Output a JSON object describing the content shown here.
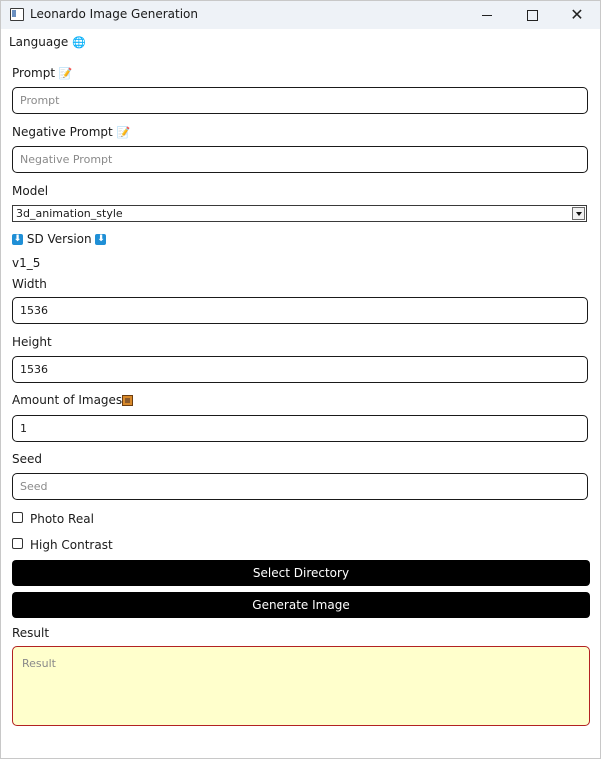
{
  "window": {
    "title": "Leonardo Image Generation",
    "controls": {
      "minimize": "minimize-icon",
      "maximize": "maximize-icon",
      "close": "close-icon"
    }
  },
  "language": {
    "label": "Language",
    "icon": "globe-icon"
  },
  "prompt": {
    "label": "Prompt",
    "icon": "memo-icon",
    "value": "",
    "placeholder": "Prompt"
  },
  "negative_prompt": {
    "label": "Negative Prompt",
    "icon": "memo-icon",
    "value": "",
    "placeholder": "Negative Prompt"
  },
  "model": {
    "label": "Model",
    "selected": "3d_animation_style"
  },
  "sd_version": {
    "label": "SD Version",
    "icon": "down-arrow-icon",
    "value": "v1_5"
  },
  "width": {
    "label": "Width",
    "value": "1536",
    "placeholder": ""
  },
  "height": {
    "label": "Height",
    "value": "1536",
    "placeholder": ""
  },
  "amount": {
    "label": "Amount of Images",
    "icon": "framed-picture-icon",
    "value": "1",
    "placeholder": ""
  },
  "seed": {
    "label": "Seed",
    "value": "",
    "placeholder": "Seed"
  },
  "options": {
    "photo_real": {
      "label": "Photo Real",
      "checked": false
    },
    "high_contrast": {
      "label": "High Contrast",
      "checked": false
    }
  },
  "buttons": {
    "select_directory": "Select Directory",
    "generate_image": "Generate Image"
  },
  "result": {
    "label": "Result",
    "placeholder": "Result",
    "value": ""
  },
  "colors": {
    "button_bg": "#000000",
    "result_bg": "#ffffcc",
    "result_border": "#b22222",
    "titlebar_bg": "#eef2f7"
  }
}
